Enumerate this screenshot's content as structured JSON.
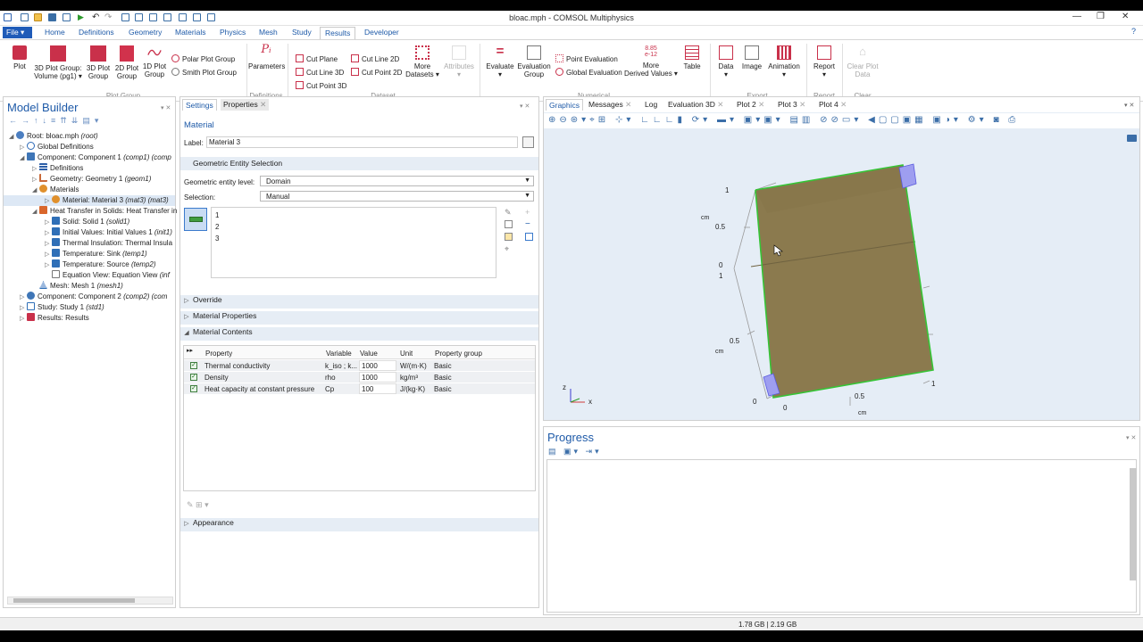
{
  "window": {
    "title": "bloac.mph - COMSOL Multiphysics"
  },
  "ribbon_tabs": {
    "file": "File ▾",
    "items": [
      "Home",
      "Definitions",
      "Geometry",
      "Materials",
      "Physics",
      "Mesh",
      "Study",
      "Results",
      "Developer"
    ],
    "help": "?"
  },
  "ribbon": {
    "plot": "Plot",
    "plot3d_group": "3D Plot Group:",
    "plot3d_group_sub": "Volume (pg1) ▾",
    "plot3d_group2": "3D Plot",
    "plot3d_group2_b": "Group",
    "plot2d_group": "2D Plot",
    "plot2d_group_b": "Group",
    "plot1d_group": "1D Plot",
    "plot1d_group_b": "Group",
    "polar": "Polar Plot Group",
    "smith": "Smith Plot Group",
    "group_plot": "Plot Group",
    "parameters": "Parameters",
    "group_definitions": "Definitions",
    "cut_plane": "Cut Plane",
    "cut_line_3d": "Cut Line 3D",
    "cut_point_3d": "Cut Point 3D",
    "cut_line_2d": "Cut Line 2D",
    "cut_point_2d": "Cut Point 2D",
    "more_datasets": "More",
    "more_datasets_b": "Datasets ▾",
    "attributes": "Attributes",
    "attributes_b": "▾",
    "group_dataset": "Dataset",
    "evaluate": "Evaluate",
    "evaluate_b": "▾",
    "evaluation_group": "Evaluation",
    "evaluation_group_b": "Group",
    "point_eval": "Point Evaluation",
    "global_eval": "Global Evaluation",
    "derived_num": "8.85",
    "derived_exp": "e-12",
    "more_derived": "More",
    "more_derived_b": "Derived Values ▾",
    "table": "Table",
    "group_numerical": "Numerical",
    "data": "Data",
    "data_b": "▾",
    "image": "Image",
    "animation": "Animation",
    "animation_b": "▾",
    "group_export": "Export",
    "report": "Report",
    "report_b": "▾",
    "group_report": "Report",
    "clear_plot": "Clear Plot",
    "clear_plot_b": "Data",
    "group_clear": "Clear"
  },
  "model_builder": {
    "title": "Model Builder",
    "tree": [
      {
        "label": "Root: bloac.mph",
        "tag": "(root)"
      },
      {
        "label": "Global Definitions",
        "tag": ""
      },
      {
        "label": "Component: Component 1",
        "tag": "(comp1) (comp"
      },
      {
        "label": "Definitions",
        "tag": ""
      },
      {
        "label": "Geometry: Geometry 1",
        "tag": "(geom1)"
      },
      {
        "label": "Materials",
        "tag": ""
      },
      {
        "label": "Material: Material 3",
        "tag": "(mat3) (mat3)"
      },
      {
        "label": "Heat Transfer in Solids: Heat Transfer in",
        "tag": ""
      },
      {
        "label": "Solid: Solid 1",
        "tag": "(solid1)"
      },
      {
        "label": "Initial Values: Initial Values 1",
        "tag": "(init1)"
      },
      {
        "label": "Thermal Insulation: Thermal Insula",
        "tag": ""
      },
      {
        "label": "Temperature: Sink",
        "tag": "(temp1)"
      },
      {
        "label": "Temperature: Source",
        "tag": "(temp2)"
      },
      {
        "label": "Equation View: Equation View",
        "tag": "(inf"
      },
      {
        "label": "Mesh: Mesh 1",
        "tag": "(mesh1)"
      },
      {
        "label": "Component: Component 2",
        "tag": "(comp2) (com"
      },
      {
        "label": "Study: Study 1",
        "tag": "(std1)"
      },
      {
        "label": "Results: Results",
        "tag": ""
      }
    ]
  },
  "settings": {
    "tabs": [
      "Settings",
      "Properties"
    ],
    "header": "Material",
    "label_caption": "Label:",
    "label_value": "Material 3",
    "geo_section": "Geometric Entity Selection",
    "entity_level_caption": "Geometric entity level:",
    "entity_level_value": "Domain",
    "selection_caption": "Selection:",
    "selection_value": "Manual",
    "selection_items": [
      "1",
      "2",
      "3"
    ],
    "override": "Override",
    "material_properties": "Material Properties",
    "material_contents": "Material Contents",
    "table_headers": [
      "Property",
      "Variable",
      "Value",
      "Unit",
      "Property group"
    ],
    "rows": [
      {
        "property": "Thermal conductivity",
        "variable": "k_iso ; k...",
        "value": "1000",
        "unit": "W/(m·K)",
        "group": "Basic"
      },
      {
        "property": "Density",
        "variable": "rho",
        "value": "1000",
        "unit": "kg/m³",
        "group": "Basic"
      },
      {
        "property": "Heat capacity at constant pressure",
        "variable": "Cp",
        "value": "100",
        "unit": "J/(kg·K)",
        "group": "Basic"
      }
    ],
    "appearance": "Appearance"
  },
  "graphics": {
    "tabs": [
      "Graphics",
      "Messages",
      "Log",
      "Evaluation 3D",
      "Plot 2",
      "Plot 3",
      "Plot 4"
    ],
    "axis_labels": {
      "z_top": "1",
      "z_mid": "0.5",
      "z_unit": "cm",
      "z_zero": "0",
      "y_one": "1",
      "y_half": "0.5",
      "y_unit": "cm",
      "y_zero": "0",
      "x_zero": "0",
      "x_half": "0.5",
      "x_one": "1",
      "x_unit": "cm"
    },
    "triad_x": "x",
    "triad_z": "z",
    "block_color": "#8b7a4e",
    "edge_color": "#36c436"
  },
  "progress": {
    "title": "Progress"
  },
  "status": {
    "memory": "1.78 GB | 2.19 GB"
  }
}
